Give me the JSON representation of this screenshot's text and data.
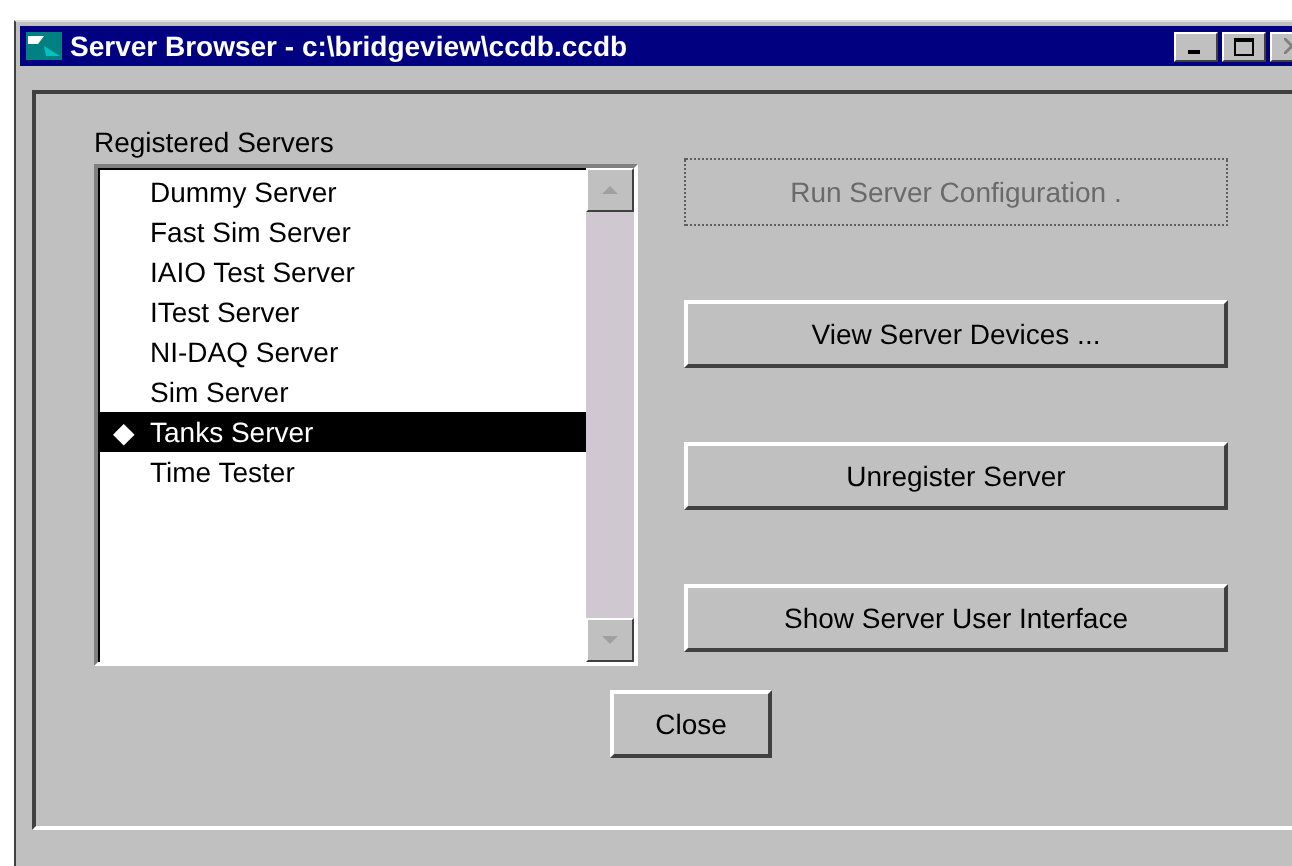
{
  "window": {
    "title": "Server Browser - c:\\bridgeview\\ccdb.ccdb"
  },
  "servers": {
    "label": "Registered Servers",
    "items": [
      {
        "name": "Dummy Server",
        "selected": false
      },
      {
        "name": "Fast Sim Server",
        "selected": false
      },
      {
        "name": "IAIO Test Server",
        "selected": false
      },
      {
        "name": "ITest Server",
        "selected": false
      },
      {
        "name": "NI-DAQ Server",
        "selected": false
      },
      {
        "name": "Sim Server",
        "selected": false
      },
      {
        "name": "Tanks Server",
        "selected": true,
        "marker": "◆"
      },
      {
        "name": "Time Tester",
        "selected": false
      }
    ]
  },
  "actions": [
    {
      "label": "Run Server Configuration .",
      "disabled": true
    },
    {
      "label": "View Server Devices ...",
      "disabled": false
    },
    {
      "label": "Unregister Server",
      "disabled": false
    },
    {
      "label": "Show Server User Interface",
      "disabled": false
    }
  ],
  "close_button": "Close"
}
